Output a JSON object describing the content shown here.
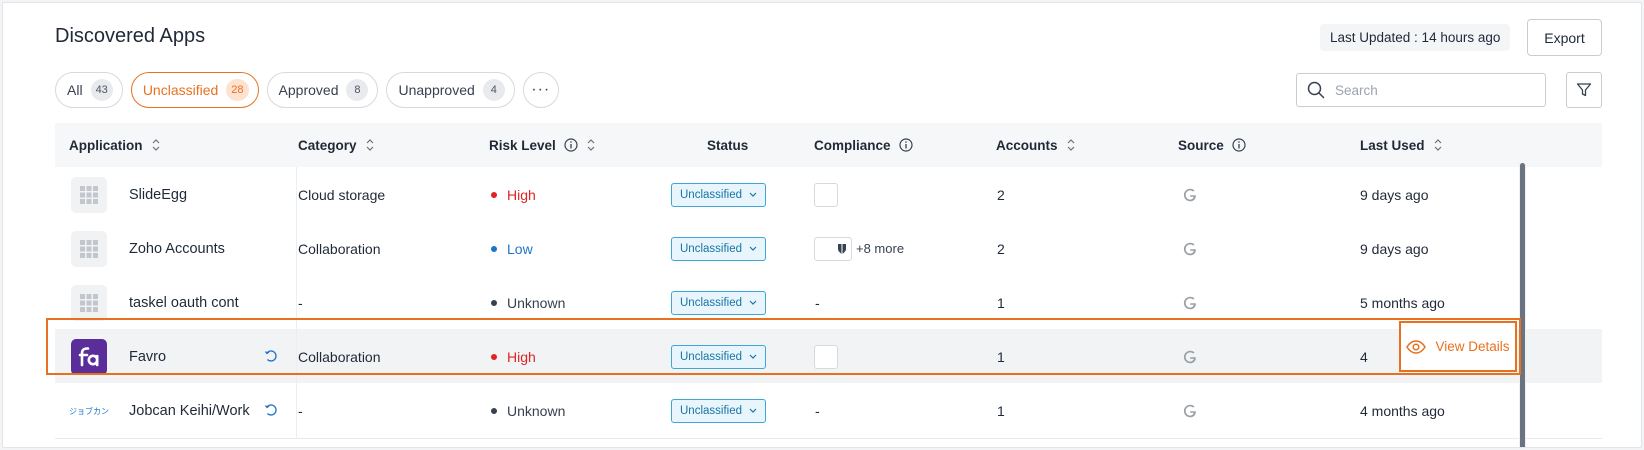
{
  "header": {
    "title": "Discovered Apps",
    "last_updated": "Last Updated : 14 hours ago",
    "export_label": "Export"
  },
  "tabs": [
    {
      "label": "All",
      "count": "43",
      "active": false
    },
    {
      "label": "Unclassified",
      "count": "28",
      "active": true
    },
    {
      "label": "Approved",
      "count": "8",
      "active": false
    },
    {
      "label": "Unapproved",
      "count": "4",
      "active": false
    }
  ],
  "more_label": "···",
  "search": {
    "placeholder": "Search",
    "value": ""
  },
  "columns": {
    "application": "Application",
    "category": "Category",
    "risk_level": "Risk Level",
    "status": "Status",
    "compliance": "Compliance",
    "accounts": "Accounts",
    "source": "Source",
    "last_used": "Last Used"
  },
  "rows": [
    {
      "name": "SlideEgg",
      "category": "Cloud storage",
      "risk": "High",
      "status": "Unclassified",
      "compliance_more": "",
      "accounts": "2",
      "last_used": "9 days ago"
    },
    {
      "name": "Zoho Accounts",
      "category": "Collaboration",
      "risk": "Low",
      "status": "Unclassified",
      "compliance_more": "+8 more",
      "accounts": "2",
      "last_used": "9 days ago"
    },
    {
      "name": "taskel oauth cont",
      "category": "-",
      "risk": "Unknown",
      "status": "Unclassified",
      "compliance": "-",
      "accounts": "1",
      "last_used": "5 months ago"
    },
    {
      "name": "Favro",
      "category": "Collaboration",
      "risk": "High",
      "status": "Unclassified",
      "accounts": "1",
      "last_used": "4"
    },
    {
      "name": "Jobcan Keihi/Work",
      "category": "-",
      "risk": "Unknown",
      "status": "Unclassified",
      "compliance": "-",
      "accounts": "1",
      "last_used": "4 months ago"
    }
  ],
  "jobcan_logo_text": "ジョブカン",
  "view_details_label": "View Details",
  "colors": {
    "accent": "#e8711f",
    "high": "#e02424",
    "low": "#1d74c9",
    "unknown": "#374151",
    "status_border": "#3fa6d6"
  }
}
